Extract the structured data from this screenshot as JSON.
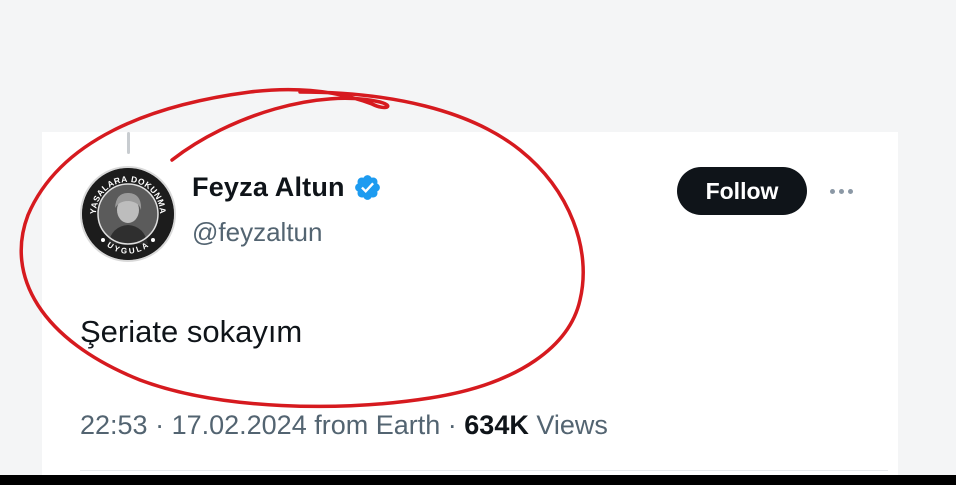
{
  "tweet": {
    "author": {
      "display_name": "Feyza Altun",
      "handle": "@feyzaltun",
      "verified": true,
      "avatar": {
        "badge_top_text": "YASALARA DOKUNMA",
        "badge_bottom_text": "UYGULA"
      }
    },
    "follow_label": "Follow",
    "text": "Şeriate sokayım",
    "meta": {
      "time": "22:53",
      "separator": " · ",
      "date": "17.02.2024",
      "source": "from Earth",
      "views_count": "634K",
      "views_label": "Views"
    }
  },
  "colors": {
    "verified_blue": "#1d9bf0",
    "annotation_red": "#d61a1f",
    "follow_bg": "#0f1419",
    "secondary_text": "#536471"
  },
  "icons": {
    "verified": "verified-badge-icon",
    "more": "more-horizontal-icon"
  }
}
